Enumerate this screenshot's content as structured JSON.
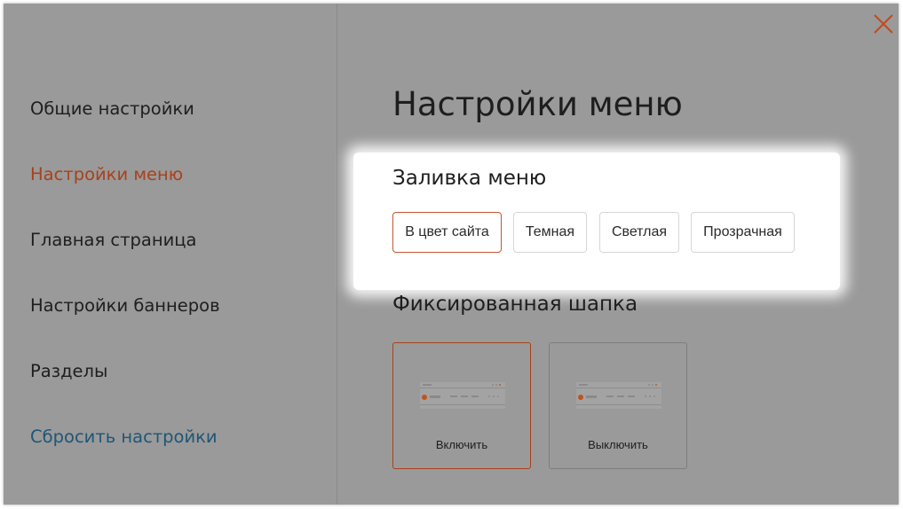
{
  "sidebar": {
    "items": [
      {
        "label": "Общие настройки"
      },
      {
        "label": "Настройки меню"
      },
      {
        "label": "Главная страница"
      },
      {
        "label": "Настройки баннеров"
      },
      {
        "label": "Разделы"
      }
    ],
    "reset_label": "Сбросить настройки"
  },
  "main": {
    "title": "Настройки меню",
    "fill_section": {
      "title": "Заливка меню",
      "options": [
        "В цвет сайта",
        "Темная",
        "Светлая",
        "Прозрачная"
      ],
      "selected": "В цвет сайта"
    },
    "fixed_header_section": {
      "title": "Фиксированная шапка",
      "options": [
        "Включить",
        "Выключить"
      ],
      "selected": "Включить"
    }
  },
  "colors": {
    "overlay": "#9a9a9a",
    "active_text": "#a8421c",
    "reset_link": "#1f5676",
    "selected_border": "#c2572d",
    "close_icon": "#c44a1a"
  }
}
